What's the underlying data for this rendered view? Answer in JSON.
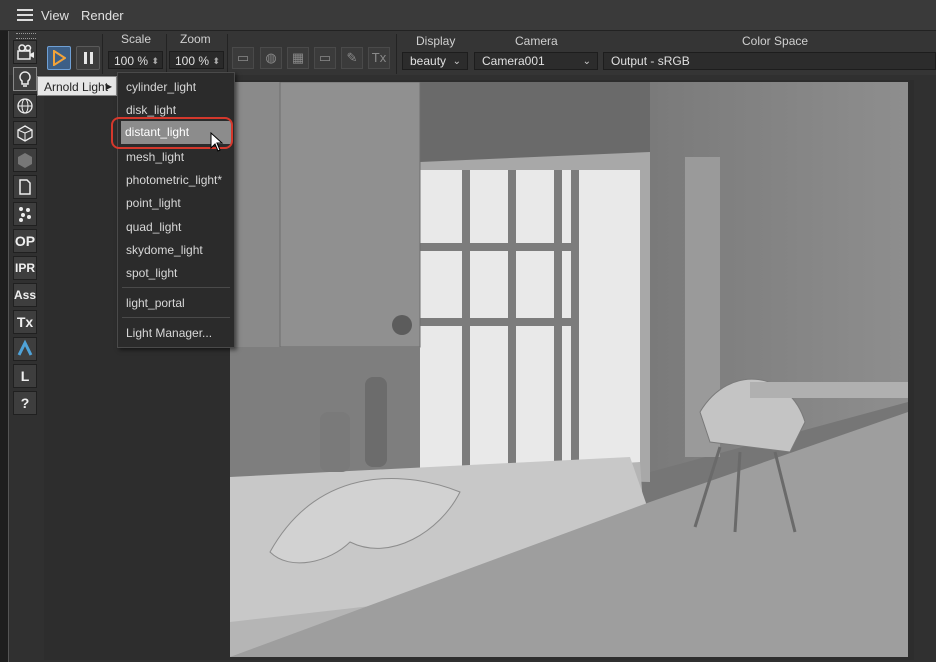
{
  "menubar": {
    "items": [
      "View",
      "Render"
    ]
  },
  "toolbar": {
    "scale": {
      "label": "Scale",
      "value": "100 %"
    },
    "zoom": {
      "label": "Zoom",
      "value": "100 %"
    },
    "icons": [
      "monitor-icon",
      "globe-icon",
      "layout-icon",
      "rectangle-icon",
      "brush-icon",
      "tx-icon"
    ],
    "tx_label": "Tx",
    "display": {
      "label": "Display",
      "value": "beauty"
    },
    "camera": {
      "label": "Camera",
      "value": "Camera001"
    },
    "color_space": {
      "label": "Color Space",
      "value": "Output - sRGB"
    }
  },
  "tools": [
    {
      "name": "camera-tool-icon",
      "glyph": ""
    },
    {
      "name": "light-tool-icon",
      "glyph": ""
    },
    {
      "name": "sky-tool-icon",
      "glyph": ""
    },
    {
      "name": "cube-tool-icon",
      "glyph": ""
    },
    {
      "name": "sphere-tool-icon",
      "glyph": ""
    },
    {
      "name": "document-tool-icon",
      "glyph": ""
    },
    {
      "name": "particles-tool-icon",
      "glyph": ""
    },
    {
      "name": "op-tool",
      "glyph": "OP"
    },
    {
      "name": "ipr-tool",
      "glyph": "IPR"
    },
    {
      "name": "ass-tool",
      "glyph": "Ass"
    },
    {
      "name": "tx-tool",
      "glyph": "Tx"
    },
    {
      "name": "arnold-tool-icon",
      "glyph": ""
    },
    {
      "name": "l-tool",
      "glyph": "L"
    },
    {
      "name": "help-tool",
      "glyph": "?"
    }
  ],
  "arnold_light_label": "Arnold Light",
  "light_menu": {
    "items": [
      "cylinder_light",
      "disk_light",
      "distant_light",
      "mesh_light",
      "photometric_light*",
      "point_light",
      "quad_light",
      "skydome_light",
      "spot_light"
    ],
    "extra": [
      "light_portal",
      "Light Manager..."
    ],
    "selected": "distant_light"
  },
  "colors": {
    "accent_ring": "#d4382c",
    "play_active": "#3d5f86"
  }
}
